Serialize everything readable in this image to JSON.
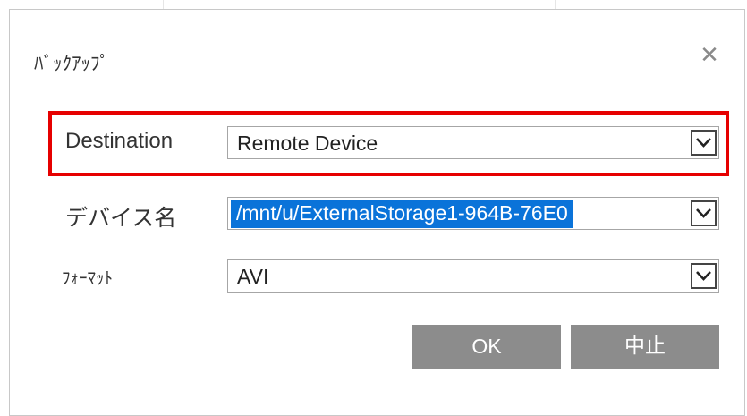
{
  "dialog": {
    "title": "ﾊﾞｯｸｱｯﾌﾟ",
    "close_glyph": "✕"
  },
  "form": {
    "destination": {
      "label": "Destination",
      "value": "Remote Device"
    },
    "device_name": {
      "label": "デバイス名",
      "value": "/mnt/u/ExternalStorage1-964B-76E0"
    },
    "format": {
      "label": "ﾌｫｰﾏｯﾄ",
      "value": "AVI"
    }
  },
  "buttons": {
    "ok": "OK",
    "cancel": "中止"
  },
  "colors": {
    "highlight_border": "#e60000",
    "selection": "#0a73d9",
    "button_bg": "#8c8c8c"
  },
  "icons": {
    "close": "close-icon",
    "dropdown": "chevron-down-icon"
  }
}
